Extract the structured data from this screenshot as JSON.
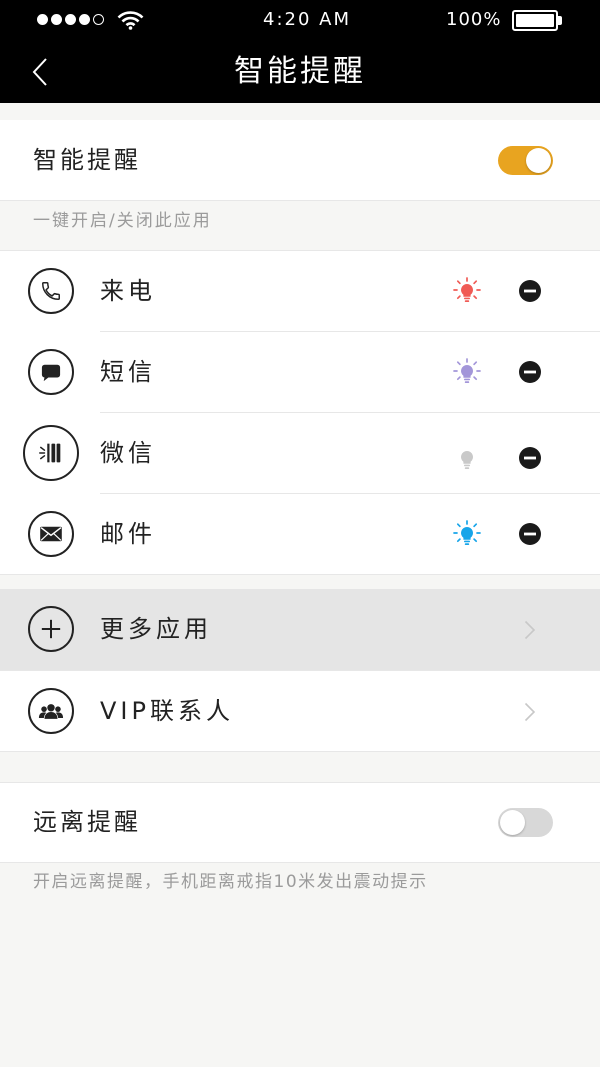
{
  "status_bar": {
    "time": "4:20 AM",
    "battery_text": "100%",
    "battery_level": 1.0,
    "signal_strength": 4,
    "signal_max": 5
  },
  "nav": {
    "back_icon": "chevron-left-icon",
    "title": "智能提醒"
  },
  "smart_reminder": {
    "label": "智能提醒",
    "enabled": true,
    "hint": "一键开启/关闭此应用"
  },
  "apps": [
    {
      "label": "来电",
      "icon": "phone-icon",
      "light_on": true,
      "light_color": "#f05b55",
      "action_icon": "remove-icon"
    },
    {
      "label": "短信",
      "icon": "message-icon",
      "light_on": true,
      "light_color": "#a396d9",
      "action_icon": "remove-icon"
    },
    {
      "label": "微信",
      "icon": "wechat-icon",
      "light_on": false,
      "light_color": "#c9c9c9",
      "action_icon": "remove-icon"
    },
    {
      "label": "邮件",
      "icon": "mail-icon",
      "light_on": true,
      "light_color": "#17a5e9",
      "action_icon": "remove-icon"
    }
  ],
  "more_apps": {
    "label": "更多应用",
    "icon": "plus-icon",
    "chevron": "chevron-right-icon"
  },
  "vip_contacts": {
    "label": "VIP联系人",
    "icon": "group-icon",
    "chevron": "chevron-right-icon"
  },
  "away_reminder": {
    "label": "远离提醒",
    "enabled": false,
    "hint": "开启远离提醒，手机距离戒指10米发出震动提示"
  },
  "colors": {
    "accent": "#e8a420",
    "toggle_off": "#d8d8d8",
    "nav_background": "#000000",
    "page_background": "#f6f6f4",
    "pressed_row": "#e5e5e5"
  }
}
